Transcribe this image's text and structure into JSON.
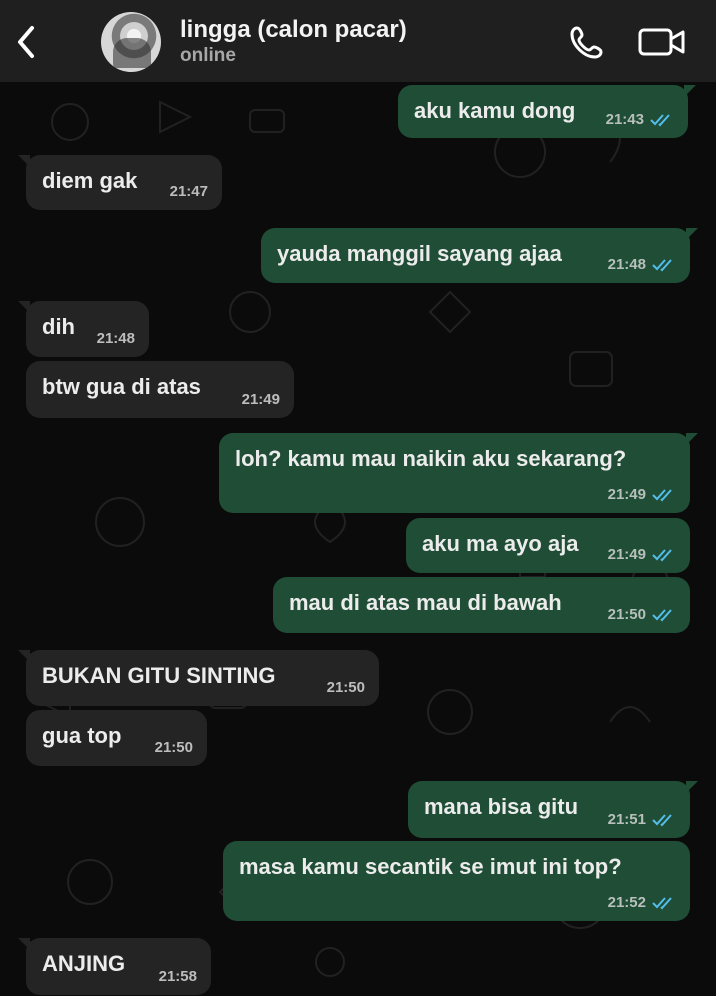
{
  "header": {
    "back_icon": "chevron-left-icon",
    "title": "lingga (calon pacar)",
    "status": "online",
    "call_icon": "phone-icon",
    "video_icon": "video-icon"
  },
  "colors": {
    "header_bg": "#1f1f1f",
    "chat_bg": "#0b0b0b",
    "incoming_bubble": "#242424",
    "outgoing_bubble": "#1f4d36",
    "read_tick": "#53bdeb"
  },
  "messages": [
    {
      "direction": "out",
      "text": "aku kamu dong",
      "time": "21:43",
      "status": "read"
    },
    {
      "direction": "in",
      "text": "diem gak",
      "time": "21:47"
    },
    {
      "direction": "out",
      "text": "yauda manggil sayang ajaa",
      "time": "21:48",
      "status": "read"
    },
    {
      "direction": "in",
      "text": "dih",
      "time": "21:48"
    },
    {
      "direction": "in",
      "text": "btw gua di atas",
      "time": "21:49"
    },
    {
      "direction": "out",
      "text": "loh? kamu mau naikin aku sekarang?",
      "time": "21:49",
      "status": "read"
    },
    {
      "direction": "out",
      "text": "aku ma ayo aja",
      "time": "21:49",
      "status": "read"
    },
    {
      "direction": "out",
      "text": "mau di atas mau di bawah",
      "time": "21:50",
      "status": "read"
    },
    {
      "direction": "in",
      "text": "BUKAN GITU SINTING",
      "time": "21:50"
    },
    {
      "direction": "in",
      "text": "gua top",
      "time": "21:50"
    },
    {
      "direction": "out",
      "text": "mana bisa gitu",
      "time": "21:51",
      "status": "read"
    },
    {
      "direction": "out",
      "text": "masa kamu secantik se imut ini top?",
      "time": "21:52",
      "status": "read"
    },
    {
      "direction": "in",
      "text": "ANJING",
      "time": "21:58"
    }
  ]
}
